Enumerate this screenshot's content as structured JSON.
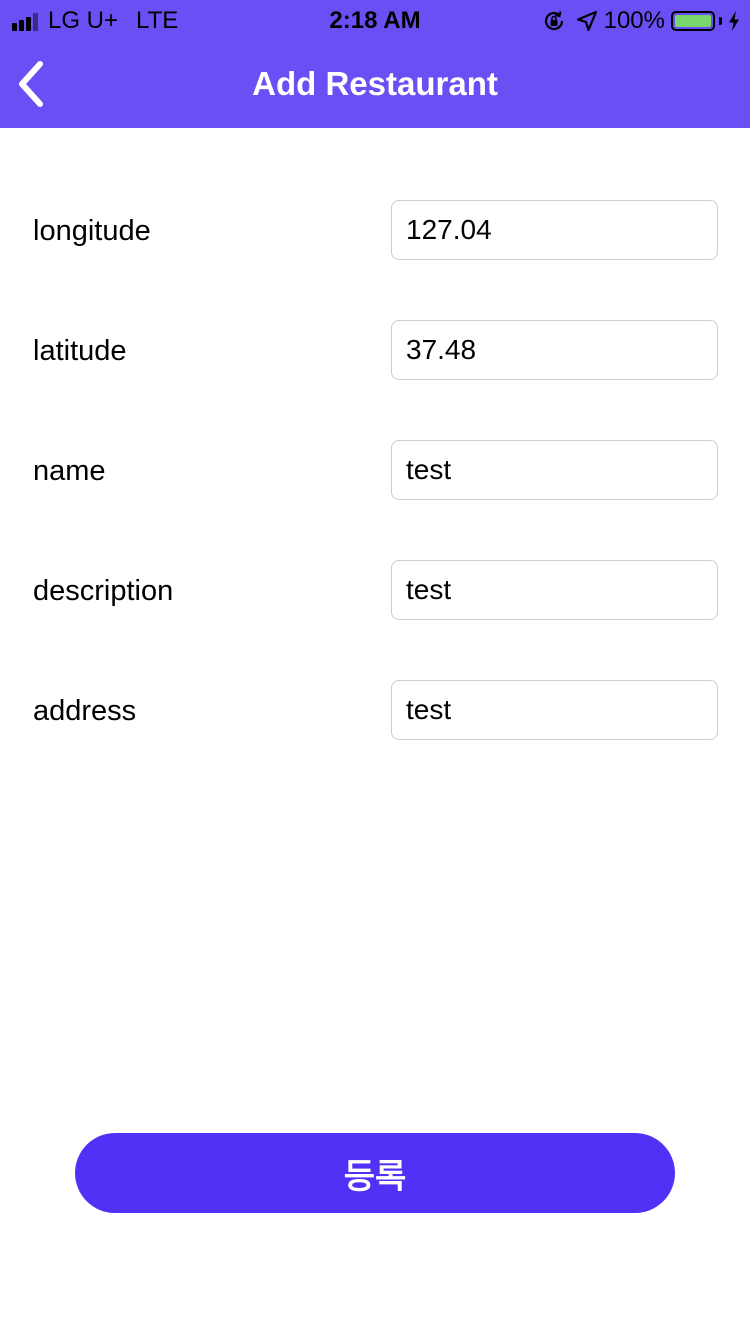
{
  "status_bar": {
    "carrier": "LG U+",
    "network": "LTE",
    "time": "2:18 AM",
    "battery_percent": "100%",
    "battery_color": "#78d66b",
    "icons": [
      "signal-icon",
      "orientation-lock-icon",
      "location-arrow-icon",
      "battery-icon",
      "charging-bolt-icon"
    ]
  },
  "header": {
    "title": "Add Restaurant",
    "background_color": "#6b4ff5",
    "back_icon": "chevron-left-icon"
  },
  "form": {
    "fields": [
      {
        "label": "longitude",
        "value": "127.04"
      },
      {
        "label": "latitude",
        "value": "37.48"
      },
      {
        "label": "name",
        "value": "test"
      },
      {
        "label": "description",
        "value": "test"
      },
      {
        "label": "address",
        "value": "test"
      }
    ]
  },
  "submit": {
    "label": "등록",
    "color": "#5230f5"
  }
}
